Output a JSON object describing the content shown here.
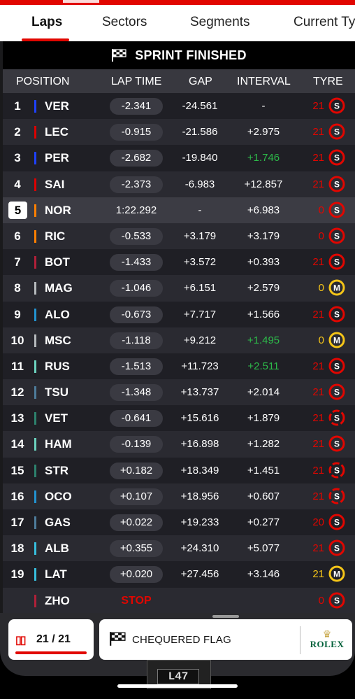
{
  "tabs": [
    {
      "label": "Laps",
      "active": true
    },
    {
      "label": "Sectors",
      "active": false
    },
    {
      "label": "Segments",
      "active": false
    },
    {
      "label": "Current Ty",
      "active": false
    }
  ],
  "banner": {
    "text": "SPRINT FINISHED",
    "icon": "chequered-flag-icon"
  },
  "columns": {
    "position": "POSITION",
    "lap_time": "LAP TIME",
    "gap": "GAP",
    "interval": "INTERVAL",
    "tyre": "TYRE"
  },
  "colors": {
    "accent": "#e10600",
    "soft_tyre": "#e10600",
    "medium_tyre": "#f5c518",
    "interval_green": "#2dbb4a"
  },
  "drivers": [
    {
      "pos": "1",
      "code": "VER",
      "team_color": "#1e41ff",
      "lap_time": "-2.341",
      "gap": "-24.561",
      "interval": "-",
      "interval_color": "white",
      "laps": "21",
      "laps_color": "#e10600",
      "tyre": "S"
    },
    {
      "pos": "2",
      "code": "LEC",
      "team_color": "#dc0000",
      "lap_time": "-0.915",
      "gap": "-21.586",
      "interval": "+2.975",
      "interval_color": "white",
      "laps": "21",
      "laps_color": "#e10600",
      "tyre": "S"
    },
    {
      "pos": "3",
      "code": "PER",
      "team_color": "#1e41ff",
      "lap_time": "-2.682",
      "gap": "-19.840",
      "interval": "+1.746",
      "interval_color": "green",
      "laps": "21",
      "laps_color": "#e10600",
      "tyre": "S"
    },
    {
      "pos": "4",
      "code": "SAI",
      "team_color": "#dc0000",
      "lap_time": "-2.373",
      "gap": "-6.983",
      "interval": "+12.857",
      "interval_color": "white",
      "laps": "21",
      "laps_color": "#e10600",
      "tyre": "S"
    },
    {
      "pos": "5",
      "code": "NOR",
      "team_color": "#ff8000",
      "lap_time": "1:22.292",
      "gap": "-",
      "interval": "+6.983",
      "interval_color": "white",
      "laps": "0",
      "laps_color": "#e10600",
      "tyre": "S",
      "highlight": true
    },
    {
      "pos": "6",
      "code": "RIC",
      "team_color": "#ff8000",
      "lap_time": "-0.533",
      "gap": "+3.179",
      "interval": "+3.179",
      "interval_color": "white",
      "laps": "0",
      "laps_color": "#e10600",
      "tyre": "S"
    },
    {
      "pos": "7",
      "code": "BOT",
      "team_color": "#b12039",
      "lap_time": "-1.433",
      "gap": "+3.572",
      "interval": "+0.393",
      "interval_color": "white",
      "laps": "21",
      "laps_color": "#e10600",
      "tyre": "S"
    },
    {
      "pos": "8",
      "code": "MAG",
      "team_color": "#b6babd",
      "lap_time": "-1.046",
      "gap": "+6.151",
      "interval": "+2.579",
      "interval_color": "white",
      "laps": "0",
      "laps_color": "#f5c518",
      "tyre": "M"
    },
    {
      "pos": "9",
      "code": "ALO",
      "team_color": "#2293d1",
      "lap_time": "-0.673",
      "gap": "+7.717",
      "interval": "+1.566",
      "interval_color": "white",
      "laps": "21",
      "laps_color": "#e10600",
      "tyre": "S"
    },
    {
      "pos": "10",
      "code": "MSC",
      "team_color": "#b6babd",
      "lap_time": "-1.118",
      "gap": "+9.212",
      "interval": "+1.495",
      "interval_color": "green",
      "laps": "0",
      "laps_color": "#f5c518",
      "tyre": "M"
    },
    {
      "pos": "11",
      "code": "RUS",
      "team_color": "#6cd3bf",
      "lap_time": "-1.513",
      "gap": "+11.723",
      "interval": "+2.511",
      "interval_color": "green",
      "laps": "21",
      "laps_color": "#e10600",
      "tyre": "S"
    },
    {
      "pos": "12",
      "code": "TSU",
      "team_color": "#4e7c9b",
      "lap_time": "-1.348",
      "gap": "+13.737",
      "interval": "+2.014",
      "interval_color": "white",
      "laps": "21",
      "laps_color": "#e10600",
      "tyre": "S"
    },
    {
      "pos": "13",
      "code": "VET",
      "team_color": "#2d826d",
      "lap_time": "-0.641",
      "gap": "+15.616",
      "interval": "+1.879",
      "interval_color": "white",
      "laps": "21",
      "laps_color": "#e10600",
      "tyre": "S",
      "used": true
    },
    {
      "pos": "14",
      "code": "HAM",
      "team_color": "#6cd3bf",
      "lap_time": "-0.139",
      "gap": "+16.898",
      "interval": "+1.282",
      "interval_color": "white",
      "laps": "21",
      "laps_color": "#e10600",
      "tyre": "S"
    },
    {
      "pos": "15",
      "code": "STR",
      "team_color": "#2d826d",
      "lap_time": "+0.182",
      "gap": "+18.349",
      "interval": "+1.451",
      "interval_color": "white",
      "laps": "21",
      "laps_color": "#e10600",
      "tyre": "S",
      "used": true
    },
    {
      "pos": "16",
      "code": "OCO",
      "team_color": "#2293d1",
      "lap_time": "+0.107",
      "gap": "+18.956",
      "interval": "+0.607",
      "interval_color": "white",
      "laps": "21",
      "laps_color": "#e10600",
      "tyre": "S",
      "used": true
    },
    {
      "pos": "17",
      "code": "GAS",
      "team_color": "#4e7c9b",
      "lap_time": "+0.022",
      "gap": "+19.233",
      "interval": "+0.277",
      "interval_color": "white",
      "laps": "20",
      "laps_color": "#e10600",
      "tyre": "S"
    },
    {
      "pos": "18",
      "code": "ALB",
      "team_color": "#37bedd",
      "lap_time": "+0.355",
      "gap": "+24.310",
      "interval": "+5.077",
      "interval_color": "white",
      "laps": "21",
      "laps_color": "#e10600",
      "tyre": "S"
    },
    {
      "pos": "19",
      "code": "LAT",
      "team_color": "#37bedd",
      "lap_time": "+0.020",
      "gap": "+27.456",
      "interval": "+3.146",
      "interval_color": "white",
      "laps": "21",
      "laps_color": "#f5c518",
      "tyre": "M"
    },
    {
      "pos": "",
      "code": "ZHO",
      "team_color": "#b12039",
      "lap_time": "STOP",
      "gap": "",
      "interval": "",
      "interval_color": "white",
      "laps": "0",
      "laps_color": "#e10600",
      "tyre": "S",
      "stopped": true
    }
  ],
  "footer": {
    "lap_current": "21",
    "lap_sep": "/",
    "lap_total": "21",
    "lap_progress": 1.0,
    "flag_message": "CHEQUERED FLAG",
    "sponsor": "ROLEX",
    "car_number": "L47"
  }
}
